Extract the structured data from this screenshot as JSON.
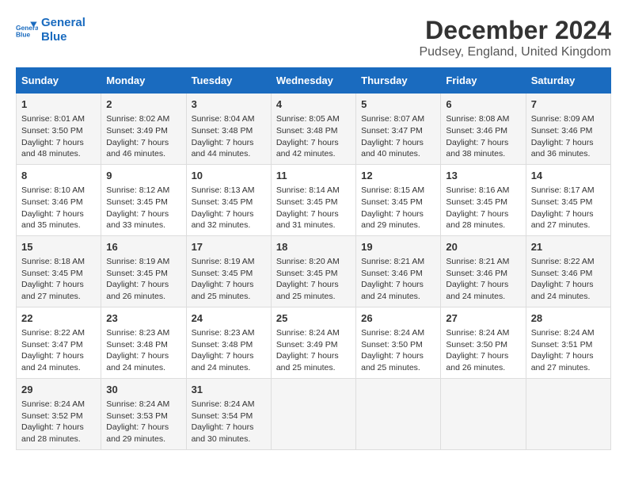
{
  "header": {
    "logo_line1": "General",
    "logo_line2": "Blue",
    "title": "December 2024",
    "subtitle": "Pudsey, England, United Kingdom"
  },
  "days_of_week": [
    "Sunday",
    "Monday",
    "Tuesday",
    "Wednesday",
    "Thursday",
    "Friday",
    "Saturday"
  ],
  "weeks": [
    [
      {
        "day": "1",
        "sunrise": "8:01 AM",
        "sunset": "3:50 PM",
        "daylight": "7 hours and 48 minutes."
      },
      {
        "day": "2",
        "sunrise": "8:02 AM",
        "sunset": "3:49 PM",
        "daylight": "7 hours and 46 minutes."
      },
      {
        "day": "3",
        "sunrise": "8:04 AM",
        "sunset": "3:48 PM",
        "daylight": "7 hours and 44 minutes."
      },
      {
        "day": "4",
        "sunrise": "8:05 AM",
        "sunset": "3:48 PM",
        "daylight": "7 hours and 42 minutes."
      },
      {
        "day": "5",
        "sunrise": "8:07 AM",
        "sunset": "3:47 PM",
        "daylight": "7 hours and 40 minutes."
      },
      {
        "day": "6",
        "sunrise": "8:08 AM",
        "sunset": "3:46 PM",
        "daylight": "7 hours and 38 minutes."
      },
      {
        "day": "7",
        "sunrise": "8:09 AM",
        "sunset": "3:46 PM",
        "daylight": "7 hours and 36 minutes."
      }
    ],
    [
      {
        "day": "8",
        "sunrise": "8:10 AM",
        "sunset": "3:46 PM",
        "daylight": "7 hours and 35 minutes."
      },
      {
        "day": "9",
        "sunrise": "8:12 AM",
        "sunset": "3:45 PM",
        "daylight": "7 hours and 33 minutes."
      },
      {
        "day": "10",
        "sunrise": "8:13 AM",
        "sunset": "3:45 PM",
        "daylight": "7 hours and 32 minutes."
      },
      {
        "day": "11",
        "sunrise": "8:14 AM",
        "sunset": "3:45 PM",
        "daylight": "7 hours and 31 minutes."
      },
      {
        "day": "12",
        "sunrise": "8:15 AM",
        "sunset": "3:45 PM",
        "daylight": "7 hours and 29 minutes."
      },
      {
        "day": "13",
        "sunrise": "8:16 AM",
        "sunset": "3:45 PM",
        "daylight": "7 hours and 28 minutes."
      },
      {
        "day": "14",
        "sunrise": "8:17 AM",
        "sunset": "3:45 PM",
        "daylight": "7 hours and 27 minutes."
      }
    ],
    [
      {
        "day": "15",
        "sunrise": "8:18 AM",
        "sunset": "3:45 PM",
        "daylight": "7 hours and 27 minutes."
      },
      {
        "day": "16",
        "sunrise": "8:19 AM",
        "sunset": "3:45 PM",
        "daylight": "7 hours and 26 minutes."
      },
      {
        "day": "17",
        "sunrise": "8:19 AM",
        "sunset": "3:45 PM",
        "daylight": "7 hours and 25 minutes."
      },
      {
        "day": "18",
        "sunrise": "8:20 AM",
        "sunset": "3:45 PM",
        "daylight": "7 hours and 25 minutes."
      },
      {
        "day": "19",
        "sunrise": "8:21 AM",
        "sunset": "3:46 PM",
        "daylight": "7 hours and 24 minutes."
      },
      {
        "day": "20",
        "sunrise": "8:21 AM",
        "sunset": "3:46 PM",
        "daylight": "7 hours and 24 minutes."
      },
      {
        "day": "21",
        "sunrise": "8:22 AM",
        "sunset": "3:46 PM",
        "daylight": "7 hours and 24 minutes."
      }
    ],
    [
      {
        "day": "22",
        "sunrise": "8:22 AM",
        "sunset": "3:47 PM",
        "daylight": "7 hours and 24 minutes."
      },
      {
        "day": "23",
        "sunrise": "8:23 AM",
        "sunset": "3:48 PM",
        "daylight": "7 hours and 24 minutes."
      },
      {
        "day": "24",
        "sunrise": "8:23 AM",
        "sunset": "3:48 PM",
        "daylight": "7 hours and 24 minutes."
      },
      {
        "day": "25",
        "sunrise": "8:24 AM",
        "sunset": "3:49 PM",
        "daylight": "7 hours and 25 minutes."
      },
      {
        "day": "26",
        "sunrise": "8:24 AM",
        "sunset": "3:50 PM",
        "daylight": "7 hours and 25 minutes."
      },
      {
        "day": "27",
        "sunrise": "8:24 AM",
        "sunset": "3:50 PM",
        "daylight": "7 hours and 26 minutes."
      },
      {
        "day": "28",
        "sunrise": "8:24 AM",
        "sunset": "3:51 PM",
        "daylight": "7 hours and 27 minutes."
      }
    ],
    [
      {
        "day": "29",
        "sunrise": "8:24 AM",
        "sunset": "3:52 PM",
        "daylight": "7 hours and 28 minutes."
      },
      {
        "day": "30",
        "sunrise": "8:24 AM",
        "sunset": "3:53 PM",
        "daylight": "7 hours and 29 minutes."
      },
      {
        "day": "31",
        "sunrise": "8:24 AM",
        "sunset": "3:54 PM",
        "daylight": "7 hours and 30 minutes."
      },
      null,
      null,
      null,
      null
    ]
  ],
  "labels": {
    "sunrise": "Sunrise:",
    "sunset": "Sunset:",
    "daylight": "Daylight:"
  }
}
